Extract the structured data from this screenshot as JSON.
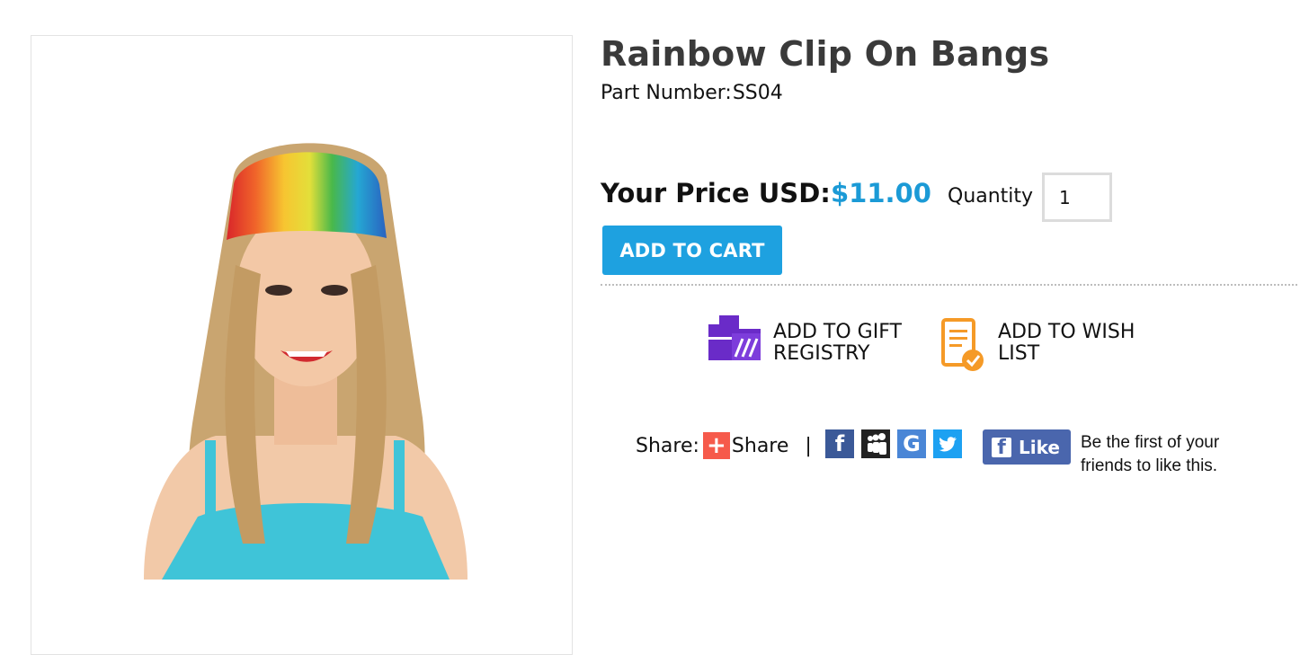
{
  "product": {
    "title": "Rainbow Clip On Bangs",
    "part_label": "Part Number:",
    "part_number": "SS04",
    "image_alt": "woman wearing rainbow clip on bangs"
  },
  "pricing": {
    "label": "Your Price USD:",
    "value": "$11.00",
    "accent_color": "#1b9ad6"
  },
  "quantity": {
    "label": "Quantity",
    "value": "1"
  },
  "cart": {
    "button_label": "ADD TO CART",
    "button_color": "#1ea1e0"
  },
  "actions": {
    "gift_registry": {
      "label": "ADD TO GIFT REGISTRY",
      "icon": "gift-registry-icon",
      "color": "#6a2bc8"
    },
    "wish_list": {
      "label": "ADD TO WISH LIST",
      "icon": "wish-list-icon",
      "color": "#f59a27"
    }
  },
  "share": {
    "label": "Share:",
    "button_text": "Share",
    "separator": "|",
    "networks": [
      "facebook-icon",
      "myspace-icon",
      "google-icon",
      "twitter-icon"
    ]
  },
  "facebook_like": {
    "button_label": "Like",
    "message": "Be the first of your friends to like this."
  }
}
